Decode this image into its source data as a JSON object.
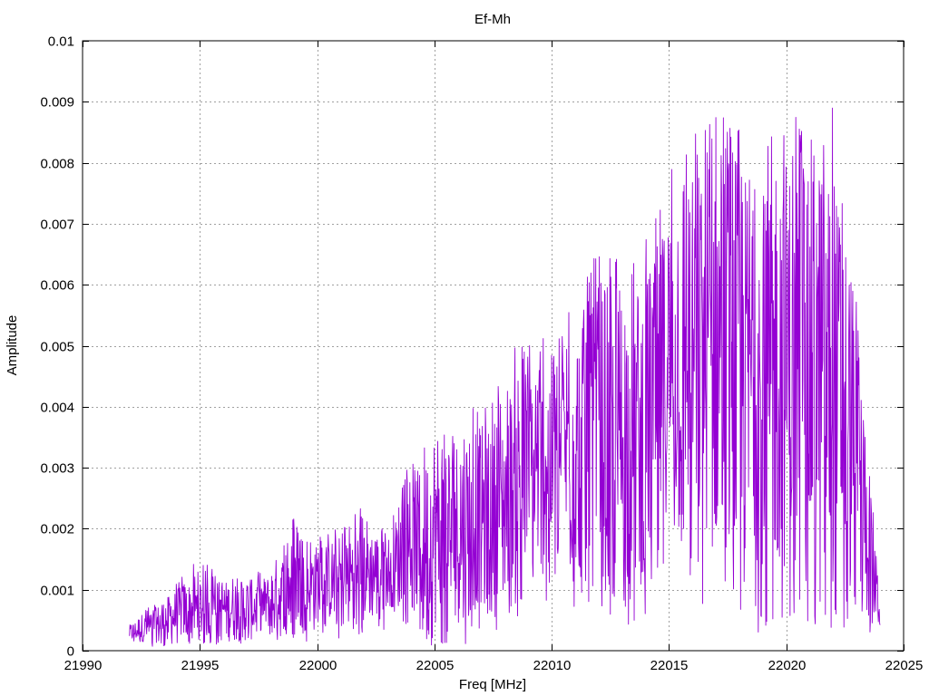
{
  "chart_data": {
    "type": "line",
    "title": "Ef-Mh",
    "xlabel": "Freq [MHz]",
    "ylabel": "Amplitude",
    "xlim": [
      21990,
      22025
    ],
    "ylim": [
      0,
      0.01
    ],
    "xticks": [
      21990,
      21995,
      22000,
      22005,
      22010,
      22015,
      22020,
      22025
    ],
    "yticks": [
      0,
      0.001,
      0.002,
      0.003,
      0.004,
      0.005,
      0.006,
      0.007,
      0.008,
      0.009,
      0.01
    ],
    "xtick_labels": [
      "21990",
      "21995",
      "22000",
      "22005",
      "22010",
      "22015",
      "22020",
      "22025"
    ],
    "ytick_labels": [
      "0",
      "0.001",
      "0.002",
      "0.003",
      "0.004",
      "0.005",
      "0.006",
      "0.007",
      "0.008",
      "0.009",
      "0.01"
    ],
    "grid": true,
    "legend": "none",
    "series_color": "#9400d3",
    "series": [
      {
        "x_start": 21992,
        "x_end": 22024,
        "envelope_x": [
          21992,
          21993,
          21994,
          21995,
          21996,
          21997,
          21998,
          21999,
          22000,
          22001,
          22002,
          22003,
          22004,
          22005,
          22006,
          22007,
          22008,
          22009,
          22010,
          22011,
          22012,
          22013,
          22014,
          22015,
          22016,
          22017,
          22018,
          22019,
          22020,
          22021,
          22022,
          22023,
          22024
        ],
        "envelope_max": [
          0.0005,
          0.0008,
          0.0012,
          0.0015,
          0.0013,
          0.0013,
          0.0014,
          0.0022,
          0.0019,
          0.0021,
          0.0024,
          0.002,
          0.0032,
          0.0039,
          0.004,
          0.0042,
          0.0045,
          0.0056,
          0.005,
          0.0062,
          0.007,
          0.0065,
          0.007,
          0.008,
          0.0085,
          0.0092,
          0.0088,
          0.008,
          0.0091,
          0.0085,
          0.009,
          0.0058,
          0.001
        ],
        "envelope_min": [
          0.0002,
          0.0001,
          0.0002,
          0.0002,
          0.0002,
          0.0002,
          0.0003,
          0.0003,
          0.0003,
          0.0004,
          0.0005,
          0.0006,
          0.0005,
          0.0002,
          0.0001,
          0.0005,
          0.0008,
          0.001,
          0.0015,
          0.0012,
          0.001,
          0.0008,
          0.001,
          0.002,
          0.0015,
          0.001,
          0.0008,
          0.0005,
          0.0005,
          0.0008,
          0.0005,
          0.0008,
          0.0004
        ],
        "envelope_mid": [
          0.0003,
          0.0004,
          0.0006,
          0.0007,
          0.0007,
          0.0007,
          0.0008,
          0.0011,
          0.0011,
          0.0012,
          0.0013,
          0.0013,
          0.0017,
          0.0019,
          0.002,
          0.0022,
          0.0025,
          0.003,
          0.0031,
          0.0034,
          0.0036,
          0.0034,
          0.0037,
          0.0048,
          0.005,
          0.005,
          0.0048,
          0.0044,
          0.0047,
          0.0046,
          0.0045,
          0.0032,
          0.0006
        ]
      }
    ]
  }
}
